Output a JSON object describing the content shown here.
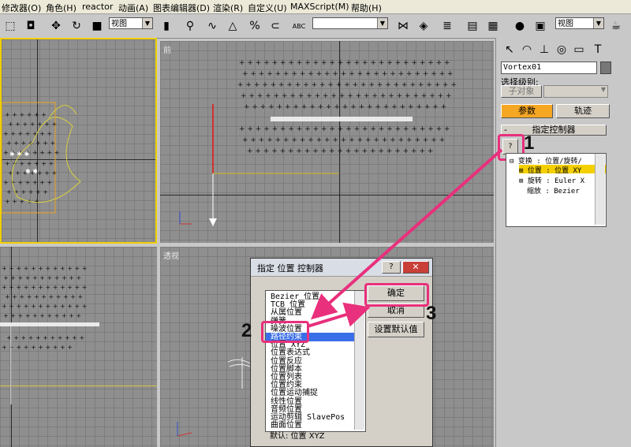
{
  "menu": [
    "修改器(O)",
    "角色(H)",
    "reactor",
    "动画(A)",
    "图表编辑器(D)",
    "渲染(R)",
    "自定义(U)",
    "MAXScript(M)",
    "帮助(H)"
  ],
  "toolbar": {
    "view_combo": "视图",
    "view_combo_right": "视图",
    "abc_label": "ABC"
  },
  "viewports": {
    "front": "前",
    "perspective": "透视"
  },
  "panel": {
    "object_name": "Vortex01",
    "selection_level_label": "选择级别:",
    "sub_object": "子对象",
    "tab_params": "参数",
    "tab_track": "轨迹",
    "rollout_title": "指定控制器",
    "tree": [
      "变换 : 位置/旋转/",
      "位置 : 位置 XY",
      "旋转 : Euler X",
      "缩放 : Bezier"
    ]
  },
  "dialog": {
    "title": "指定 位置 控制器",
    "help": "?",
    "close": "✕",
    "ok": "确定",
    "cancel": "取消",
    "set_default": "设置默认值",
    "default_label": "默认: 位置 XYZ",
    "items": [
      "Bezier 位置",
      "TCB 位置",
      "从属位置",
      "弹簧",
      "噪波位置",
      "路径约束",
      "位置 XYZ",
      "位置表达式",
      "位置反应",
      "位置脚本",
      "位置列表",
      "位置约束",
      "位置运动捕捉",
      "线性位置",
      "音频位置",
      "运动剪辑 SlavePos",
      "曲面位置"
    ],
    "selected_index": 5
  },
  "callouts": [
    "1",
    "2",
    "3"
  ],
  "colors": {
    "highlight": "#e8307c",
    "selection_blue": "#3a6ee8",
    "tab_active": "#f5a623"
  }
}
